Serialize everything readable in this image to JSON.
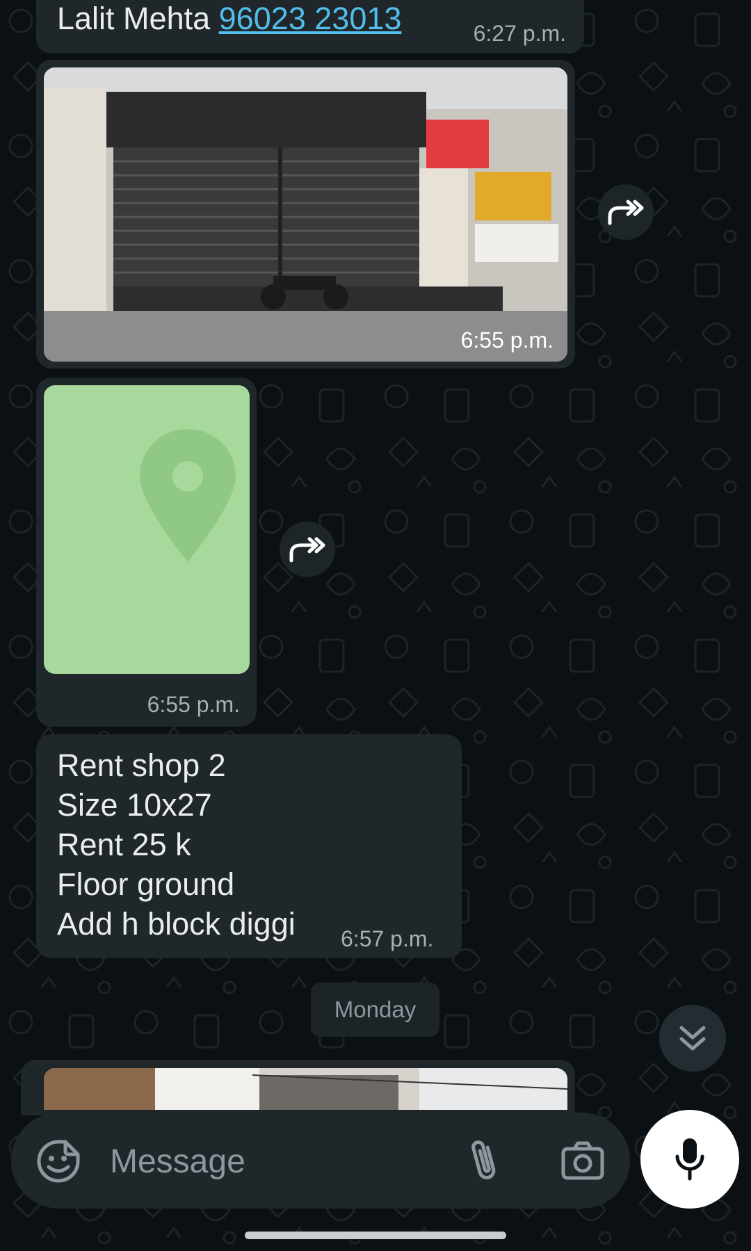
{
  "chat": {
    "contact_message": {
      "name": "Lalit Mehta",
      "phone": "96023 23013",
      "time": "6:27 p.m."
    },
    "photo_message": {
      "time": "6:55 p.m.",
      "icon": "forward-icon"
    },
    "location_message": {
      "time": "6:55 p.m.",
      "icon": "location-pin-icon"
    },
    "text_message": {
      "lines": [
        "Rent shop 2",
        "Size 10x27",
        "Rent 25 k",
        "Floor ground",
        "Add h block diggi"
      ],
      "time": "6:57 p.m."
    },
    "date_separator": "Monday"
  },
  "composer": {
    "placeholder": "Message",
    "icons": [
      "sticker-icon",
      "attach-icon",
      "camera-icon",
      "mic-icon"
    ]
  },
  "colors": {
    "background": "#0b1014",
    "bubble": "#1f272a",
    "link": "#53bdeb",
    "map": "#a8d99c"
  }
}
